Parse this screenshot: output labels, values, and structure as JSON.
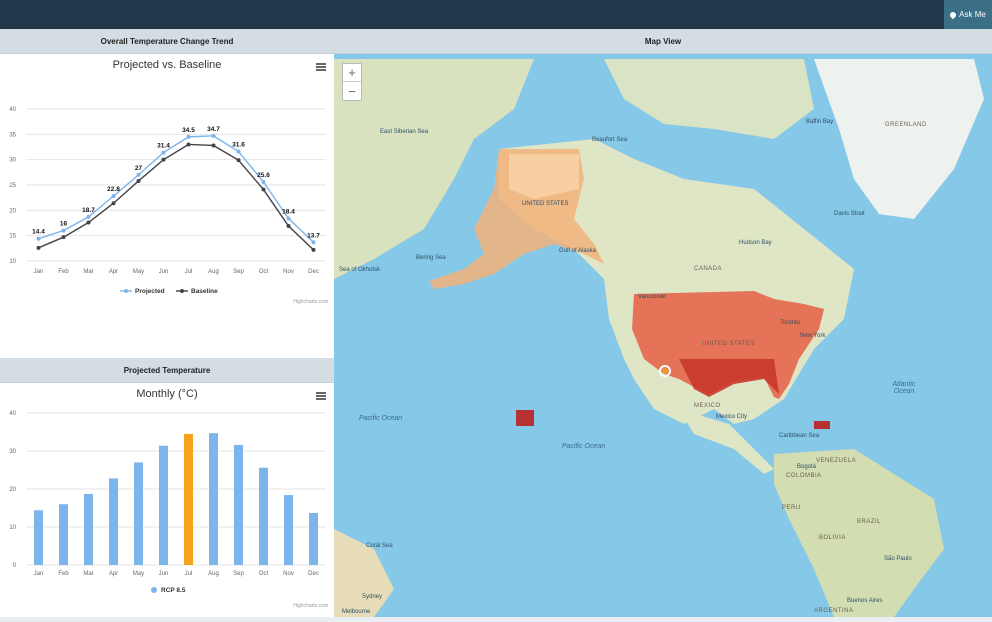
{
  "topbar": {
    "ask_label": "Ask Me"
  },
  "left": {
    "trend_header": "Overall Temperature Change Trend",
    "projected_header": "Projected Temperature"
  },
  "trend_chart": {
    "title": "Projected vs. Baseline",
    "legend": [
      "Projected",
      "Baseline"
    ],
    "credits": "Highcharts.com"
  },
  "monthly_chart": {
    "title": "Monthly (°C)",
    "legend": [
      "RCP 8.5"
    ],
    "credits": "Highcharts.com"
  },
  "chart_data": [
    {
      "type": "line",
      "title": "Projected vs. Baseline",
      "categories": [
        "Jan",
        "Feb",
        "Mar",
        "Apr",
        "May",
        "Jun",
        "Jul",
        "Aug",
        "Sep",
        "Oct",
        "Nov",
        "Dec"
      ],
      "ylim": [
        10,
        40
      ],
      "yticks": [
        10,
        15,
        20,
        25,
        30,
        35,
        40
      ],
      "series": [
        {
          "name": "Projected",
          "color": "#7cb5ec",
          "values": [
            14.4,
            16,
            18.7,
            22.8,
            27,
            31.4,
            34.5,
            34.7,
            31.6,
            25.6,
            18.4,
            13.7
          ],
          "labels": [
            "14.4",
            "16",
            "18.7",
            "22.8",
            "27",
            "31.4",
            "34.5",
            "34.7",
            "31.6",
            "25.6",
            "18.4",
            "13.7"
          ]
        },
        {
          "name": "Baseline",
          "color": "#434348",
          "values": [
            12.6,
            14.7,
            17.6,
            21.4,
            25.8,
            30,
            33,
            32.8,
            29.9,
            24.1,
            16.9,
            12.2
          ]
        }
      ],
      "legend_position": "bottom"
    },
    {
      "type": "bar",
      "title": "Monthly (°C)",
      "categories": [
        "Jan",
        "Feb",
        "Mar",
        "Apr",
        "May",
        "Jun",
        "Jul",
        "Aug",
        "Sep",
        "Oct",
        "Nov",
        "Dec"
      ],
      "ylim": [
        0,
        40
      ],
      "yticks": [
        0,
        10,
        20,
        30,
        40
      ],
      "series": [
        {
          "name": "RCP 8.5",
          "color": "#7cb5ec",
          "values": [
            14.4,
            16,
            18.7,
            22.8,
            27,
            31.4,
            34.5,
            34.7,
            31.6,
            25.6,
            18.4,
            13.7
          ]
        }
      ],
      "highlight_index": 6,
      "highlight_color": "#f7a21b",
      "legend_position": "bottom"
    }
  ],
  "map": {
    "header": "Map View",
    "zoom_in": "+",
    "zoom_out": "−",
    "labels": {
      "east_siberian_sea": "East Siberian Sea",
      "beaufort_sea": "Beaufort Sea",
      "baffin_bay": "Baffin Bay",
      "greenland": "GREENLAND",
      "davis_strait": "Davis Strait",
      "hudson_bay": "Hudson Bay",
      "bering_sea": "Bering Sea",
      "gulf_of_alaska": "Gulf of Alaska",
      "sea_of_okhotsk": "Sea of Okhotsk",
      "canada": "CANADA",
      "vancouver": "Vancouver",
      "toronto": "Toronto",
      "new_york": "New York",
      "united_states": "UNITED STATES",
      "united_states_ak": "UNITED STATES",
      "pacific_ocean_1": "Pacific Ocean",
      "pacific_ocean_2": "Pacific Ocean",
      "mexico": "MEXICO",
      "mexico_city": "Mexico City",
      "caribbean_sea": "Caribbean Sea",
      "atlantic_ocean": "Atlantic Ocean",
      "venezuela": "VENEZUELA",
      "bogota": "Bogotá",
      "colombia": "COLOMBIA",
      "peru": "PERU",
      "brazil": "BRAZIL",
      "bolivia": "BOLIVIA",
      "sao_paulo": "São Paulo",
      "coral_sea": "Coral Sea",
      "sydney": "Sydney",
      "melbourne": "Melbourne",
      "buenos_aires": "Buenos Aires",
      "argentina": "ARGENTINA"
    }
  }
}
